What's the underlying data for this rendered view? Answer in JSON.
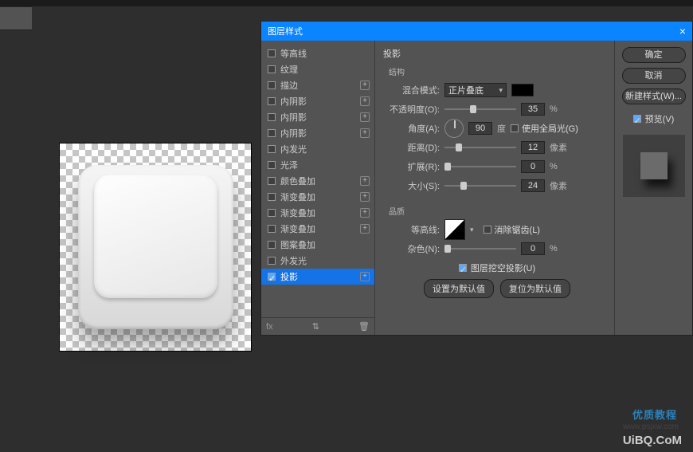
{
  "dialog": {
    "title": "图层样式",
    "effects": [
      {
        "label": "等高线",
        "checked": false,
        "plus": false
      },
      {
        "label": "纹理",
        "checked": false,
        "plus": false
      },
      {
        "label": "描边",
        "checked": false,
        "plus": true
      },
      {
        "label": "内阴影",
        "checked": false,
        "plus": true
      },
      {
        "label": "内阴影",
        "checked": false,
        "plus": true
      },
      {
        "label": "内阴影",
        "checked": false,
        "plus": true
      },
      {
        "label": "内发光",
        "checked": false,
        "plus": false
      },
      {
        "label": "光泽",
        "checked": false,
        "plus": false
      },
      {
        "label": "颜色叠加",
        "checked": false,
        "plus": true
      },
      {
        "label": "渐变叠加",
        "checked": false,
        "plus": true
      },
      {
        "label": "渐变叠加",
        "checked": false,
        "plus": true
      },
      {
        "label": "渐变叠加",
        "checked": false,
        "plus": true
      },
      {
        "label": "图案叠加",
        "checked": false,
        "plus": false
      },
      {
        "label": "外发光",
        "checked": false,
        "plus": false
      },
      {
        "label": "投影",
        "checked": true,
        "plus": true,
        "selected": true
      }
    ],
    "fxFooter": "fx",
    "section": {
      "title": "投影",
      "subtitle": "结构",
      "blendMode": {
        "label": "混合模式:",
        "value": "正片叠底"
      },
      "opacity": {
        "label": "不透明度(O):",
        "value": "35",
        "unit": "%",
        "thumb": 35
      },
      "angle": {
        "label": "角度(A):",
        "value": "90",
        "unit": "度",
        "globalLabel": "使用全局光(G)",
        "globalChecked": false
      },
      "distance": {
        "label": "距离(D):",
        "value": "12",
        "unit": "像素",
        "thumb": 15
      },
      "spread": {
        "label": "扩展(R):",
        "value": "0",
        "unit": "%",
        "thumb": 0
      },
      "size": {
        "label": "大小(S):",
        "value": "24",
        "unit": "像素",
        "thumb": 22
      },
      "qualityTitle": "品质",
      "contour": {
        "label": "等高线:",
        "antiAliasLabel": "消除锯齿(L)",
        "antiAlias": false
      },
      "noise": {
        "label": "杂色(N):",
        "value": "0",
        "unit": "%",
        "thumb": 0
      },
      "knockout": {
        "label": "图层挖空投影(U)",
        "checked": true
      },
      "defaults": {
        "make": "设置为默认值",
        "reset": "复位为默认值"
      }
    },
    "actions": {
      "ok": "确定",
      "cancel": "取消",
      "newStyle": "新建样式(W)...",
      "preview": "预览(V)"
    }
  },
  "watermark": {
    "line1": "优质教程",
    "line2": "www.psjxw.com",
    "line3": "UiBQ.CoM"
  }
}
